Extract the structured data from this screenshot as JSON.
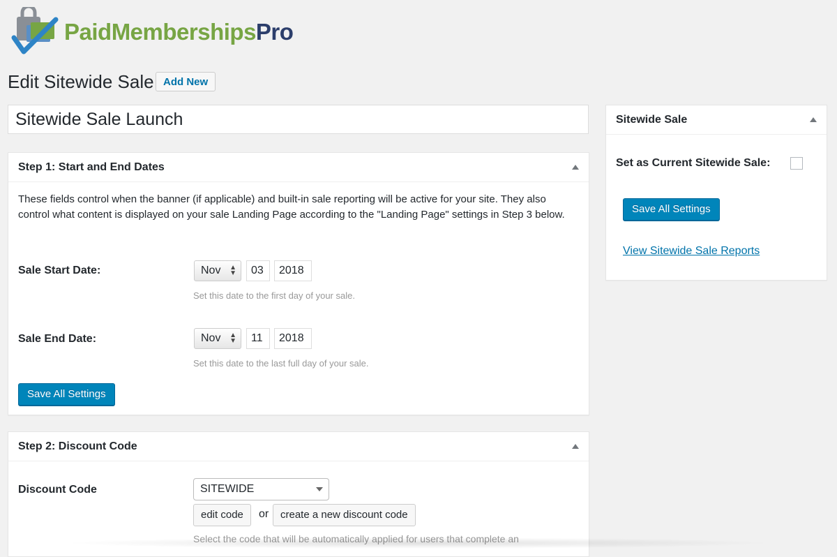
{
  "brand": {
    "name_part1": "PaidMemberships",
    "name_part2": "Pro"
  },
  "header": {
    "title": "Edit Sitewide Sale",
    "add_new_label": "Add New"
  },
  "post_title": "Sitewide Sale Launch",
  "step1": {
    "title": "Step 1: Start and End Dates",
    "description": "These fields control when the banner (if applicable) and built-in sale reporting will be active for your site. They also control what content is displayed on your sale Landing Page according to the \"Landing Page\" settings in Step 3 below.",
    "start": {
      "label": "Sale Start Date:",
      "month": "Nov",
      "day": "03",
      "year": "2018",
      "help": "Set this date to the first day of your sale."
    },
    "end": {
      "label": "Sale End Date:",
      "month": "Nov",
      "day": "11",
      "year": "2018",
      "help": "Set this date to the last full day of your sale."
    },
    "save_label": "Save All Settings"
  },
  "step2": {
    "title": "Step 2: Discount Code",
    "label": "Discount Code",
    "selected": "SITEWIDE",
    "edit_label": "edit code",
    "or_text": "or",
    "create_label": "create a new discount code",
    "help": "Select the code that will be automatically applied for users that complete an"
  },
  "sidebar": {
    "title": "Sitewide Sale",
    "current_label": "Set as Current Sitewide Sale:",
    "current_checked": false,
    "save_label": "Save All Settings",
    "reports_link": "View Sitewide Sale Reports"
  },
  "colors": {
    "primary": "#0085ba",
    "link": "#0073aa",
    "brand_green": "#77a544",
    "brand_navy": "#2c3e6b"
  }
}
